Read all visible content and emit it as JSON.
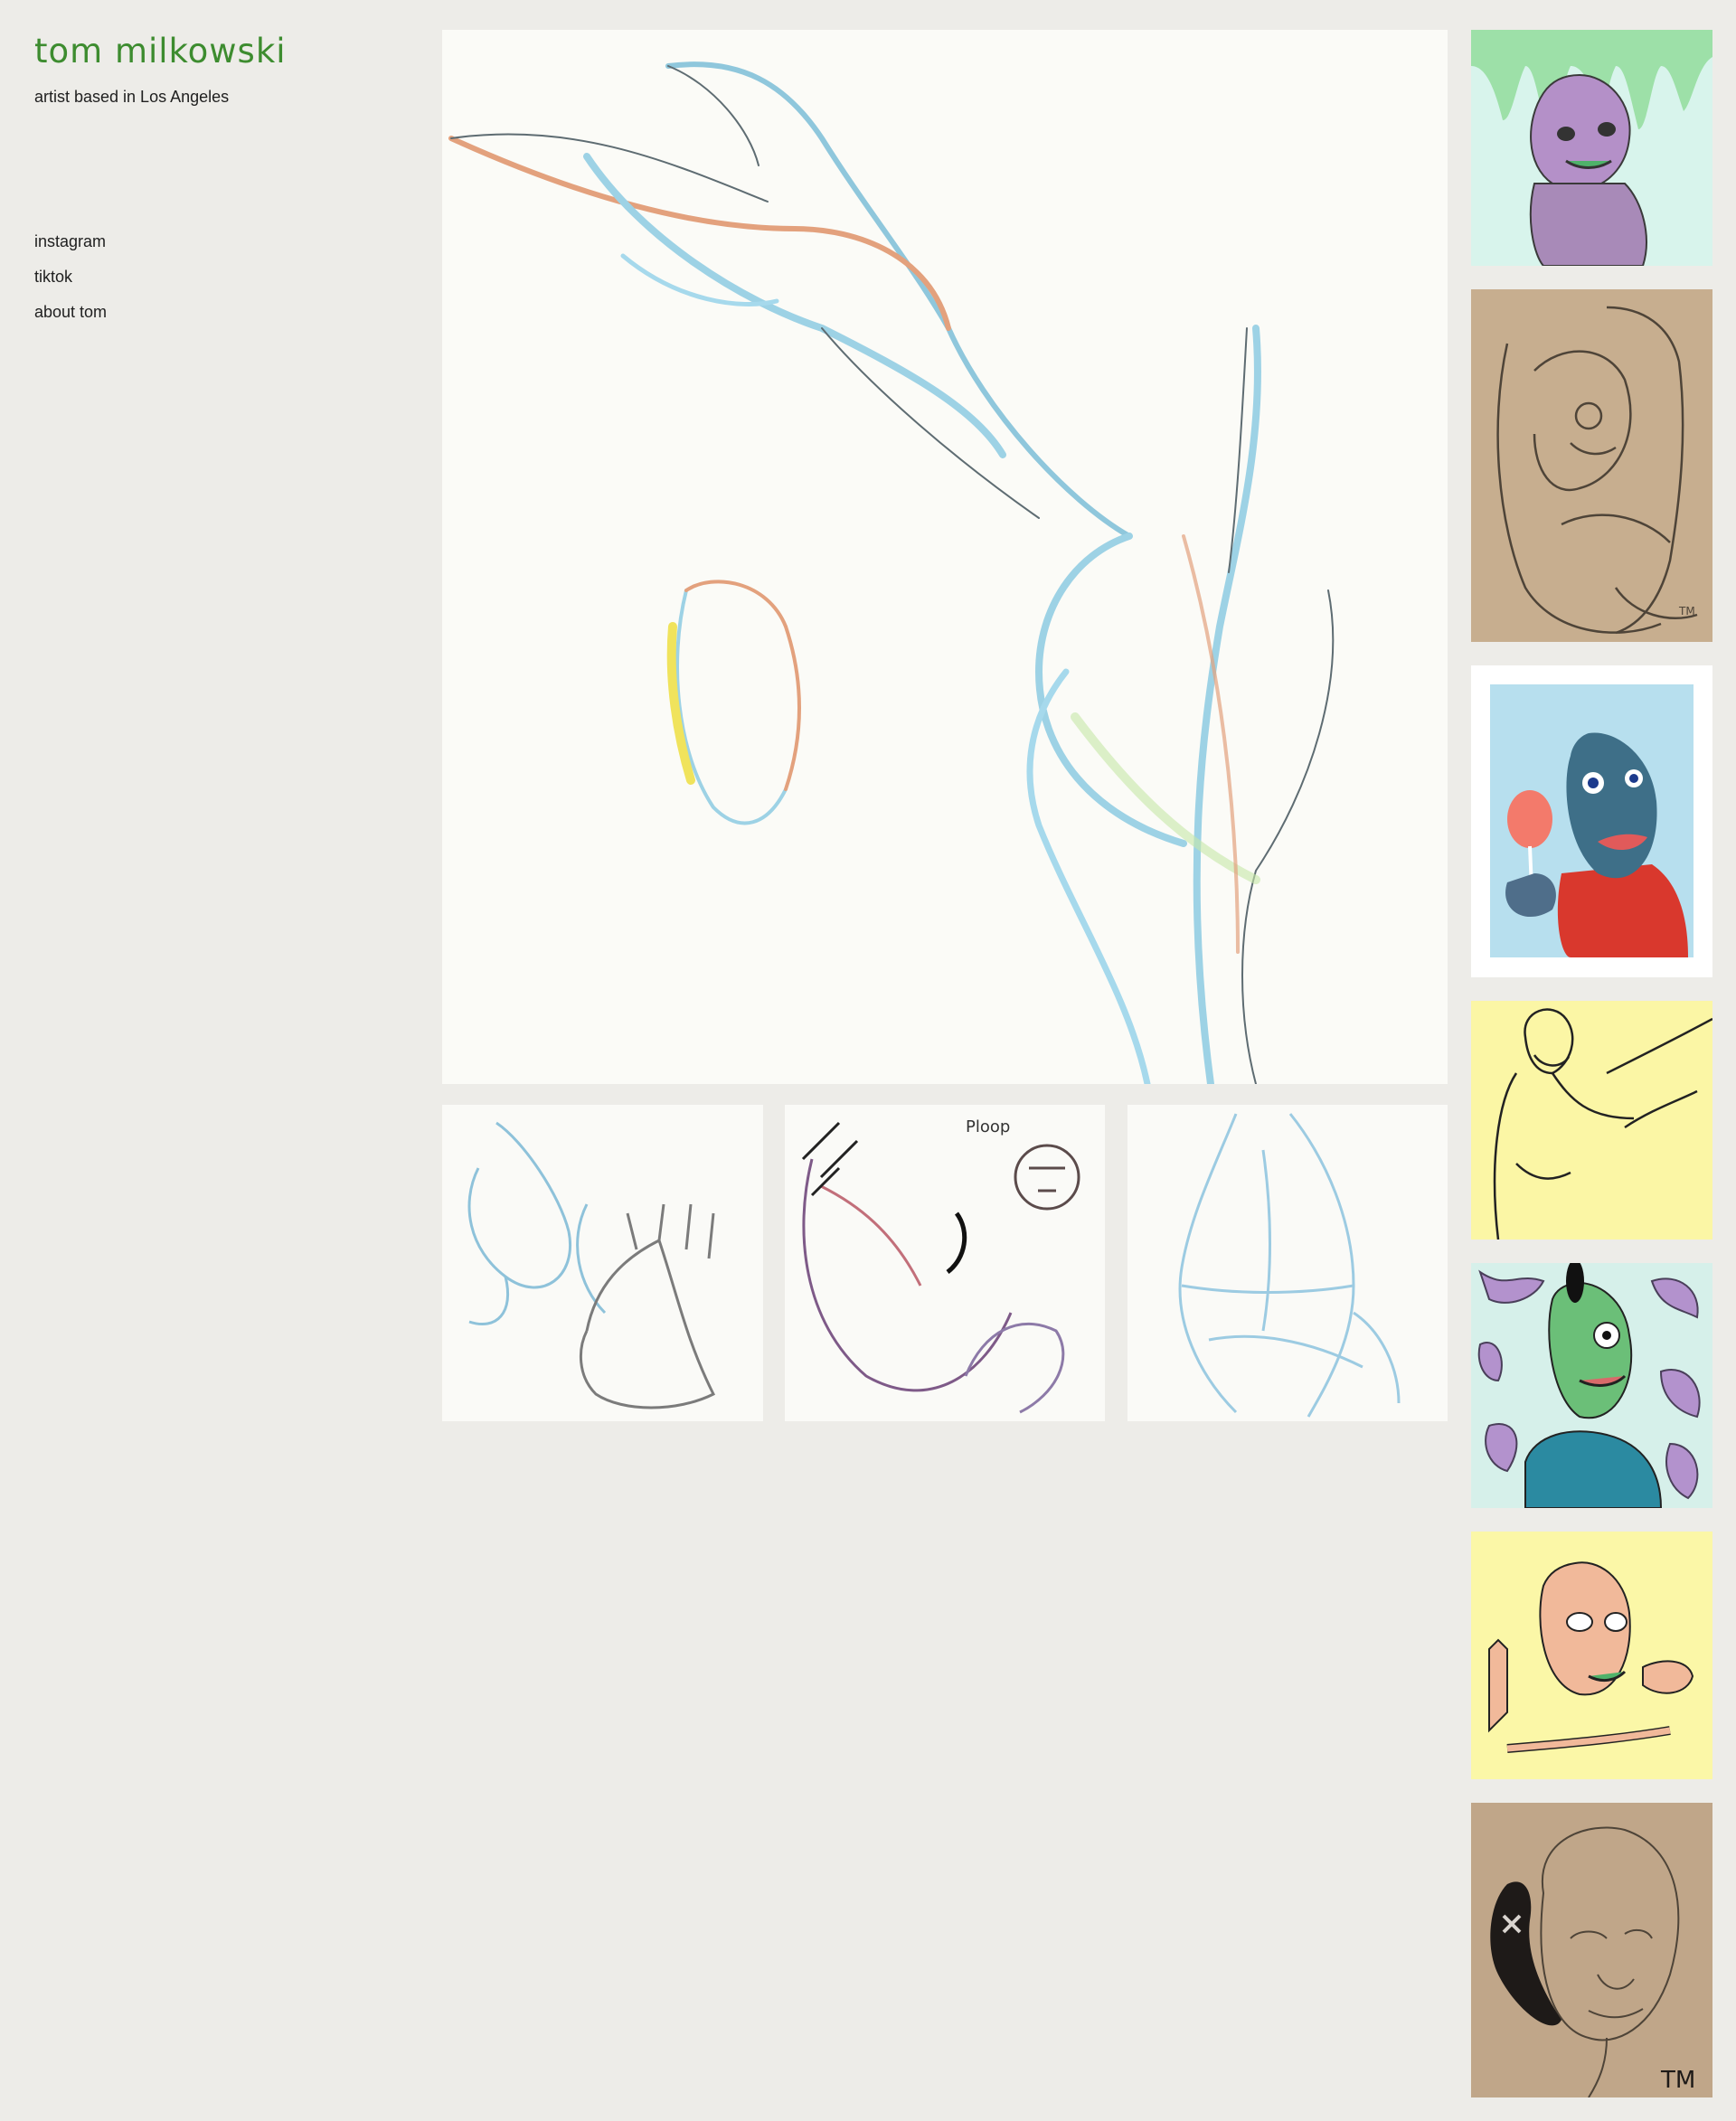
{
  "site": {
    "title": "tom milkowski",
    "tagline": "artist based in Los Angeles"
  },
  "nav": {
    "instagram": "instagram",
    "tiktok": "tiktok",
    "about": "about tom"
  },
  "colors": {
    "background": "#edece8",
    "title": "#3d8c2f",
    "text": "#1f1f1f"
  }
}
